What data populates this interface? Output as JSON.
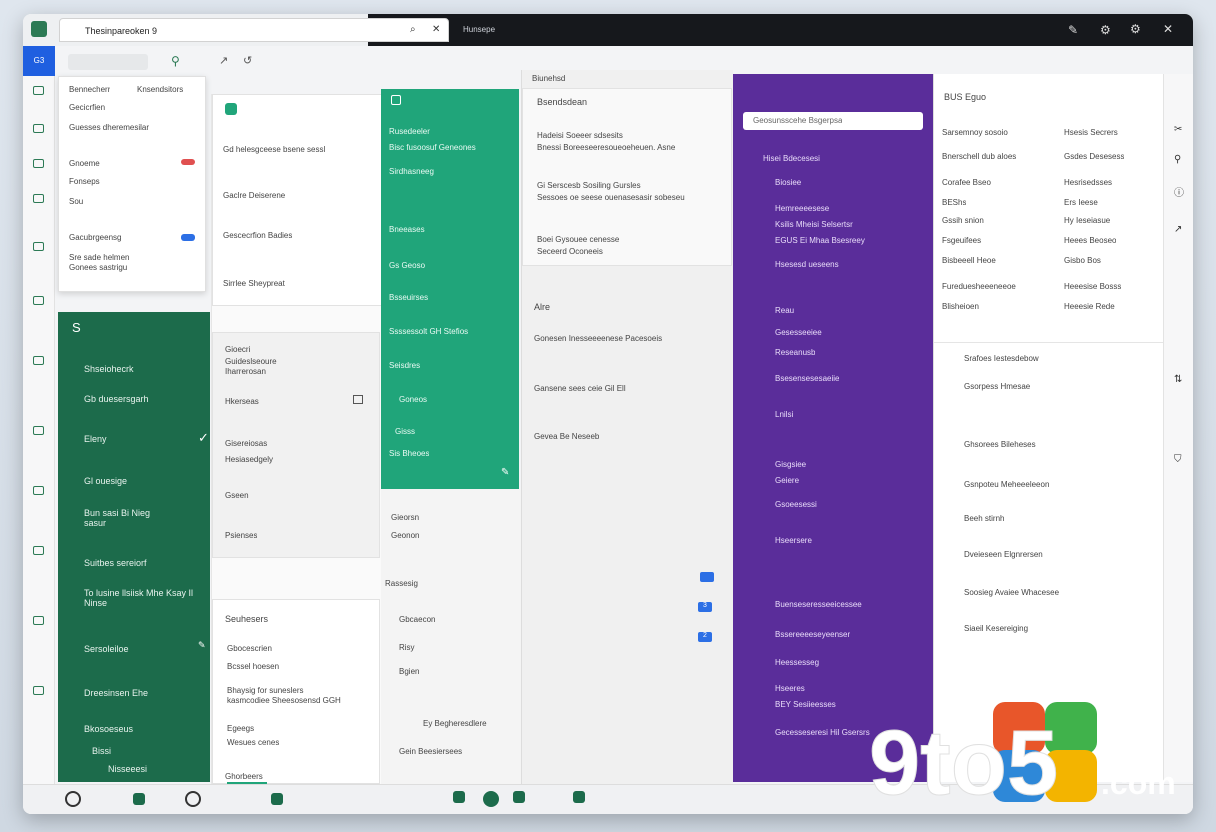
{
  "browser": {
    "active_tab": "Thesinpareoken 9",
    "dark_tab": "Hunsepe",
    "rail_active_label": "G3",
    "addr_text": "Biunehsd"
  },
  "dropdown": {
    "header_left": "Bennecherr",
    "header_right": "Knsendsitors",
    "items": [
      "Gecicrfien",
      "Guesses dheremesilar",
      "Gnoeme",
      "Fonseps",
      "Sou",
      "Gacubrgeensg",
      "Sre sade helmen Gonees sastrigu"
    ]
  },
  "green_panel": {
    "letter": "S",
    "items": [
      "Shseiohecrk",
      "Gb duesersgarh",
      "Eleny",
      "Gl ouesige",
      "Bun sasi Bi Nieg sasur",
      "Suitbes sereiorf",
      "To lusine llsiisk Mhe Ksay Il Ninse",
      "Sersoleiloe",
      "Dreesinsen Ehe",
      "Bkosoeseus",
      "Bissi",
      "Nisseeesi"
    ]
  },
  "column2": {
    "top_card": [
      "Gd helesgceese bsene sessl",
      "Gaclre Deiserene",
      "Gescecrfion Badies",
      "Sirrlee Sheypreat"
    ],
    "mid_card": [
      "Gioecri",
      "Guideslseoure Iharrerosan",
      "Hkerseas",
      "Gisereiosas",
      "Hesiasedgely",
      "Gseen",
      "Psienses"
    ],
    "section_title": "Seuhesers",
    "list": [
      "Gbocescrien",
      "Bcssel hoesen",
      "Bhaysig for suneslers kasmcodiee Sheesosensd GGH",
      "Egeegs",
      "Wesues cenes",
      "Ghorbeers"
    ]
  },
  "teal_panel": {
    "items": [
      "Rusedeeler",
      "Bisc fusoosuf Geneones",
      "Sirdhasneeg",
      "Bneeases",
      "Gs Geoso",
      "Bsseuirses",
      "Ssssessolt GH Stefios",
      "Seisdres",
      "Goneos",
      "Gisss",
      "Sis Bheoes"
    ]
  },
  "column3": {
    "items": [
      "Gieorsn",
      "Geonon",
      "Rassesig",
      "Gbcaecon",
      "Risy",
      "Bgien",
      "Ey Begheresdlere",
      "Gein Beesiersees"
    ]
  },
  "column4": {
    "title": "Bsendsdean",
    "block1": [
      "Hadeisi Soeeer sdsesits",
      "Bnessi Boreeseeresoueoeheuen. Asne"
    ],
    "block2": [
      "Gi Serscesb Sosiling Gursles",
      "Sessoes oe seese ouenasesasir sobeseu"
    ],
    "block3": [
      "Boei Gysouee cenesse",
      "Seceerd Oconeeis"
    ],
    "section": "Alre",
    "items": [
      "Gonesen Inesseeeenese Pacesoeis",
      "Gansene sees ceie Gil Ell",
      "Gevea Be Neseeb"
    ],
    "counts": [
      "3",
      "2"
    ]
  },
  "purple_panel": {
    "search_placeholder": "Geosunsscehe Bsgerpsa",
    "header": "Hisei Bdecesesi",
    "items": [
      "Biosiee",
      "Hemreeeesese",
      "Ksilis Mheisi Selsertsr",
      "EGUS Ei Mhaa Bsesreey",
      "Hsesesd ueseens",
      "Reau",
      "Gesesseeiee",
      "Reseanusb",
      "Bsesensesesaeiie",
      "Lnilsi",
      "Gisgsiee",
      "Geiere",
      "Gsoeesessi",
      "Hseersere",
      "Buenseseresseeicessee",
      "Bssereeeeseyeenser",
      "Heessesseg",
      "Hseeres",
      "BEY Sesiieesses",
      "Gecesseseresi Hil Gsersrs"
    ]
  },
  "column6": {
    "title": "BUS Eguo",
    "rows": [
      [
        "Sarsemnoy sosoio",
        "Hsesis Secrers"
      ],
      [
        "Bnerschell dub aloes",
        "Gsdes Desesess"
      ],
      [
        "Corafee Bseo",
        "Hesrisedsses"
      ],
      [
        "BEShs",
        "Ers Ieese"
      ],
      [
        "Gssih snion",
        "Hy Ieseiasue"
      ],
      [
        "Fsgeuifees",
        "Heees Beoseo"
      ],
      [
        "Bisbeeell Heoe",
        "Gisbo Bos"
      ],
      [
        "Fureduesheeeneeoe",
        "Heeesise Bosss"
      ],
      [
        "Blisheioen",
        "Heeesie Rede"
      ]
    ],
    "list": [
      "Srafoes Iestesdebow",
      "Gsorpess Hmesae",
      "Ghsorees Bileheses",
      "Gsnpoteu Meheeeleeon",
      "Beeh stirnh",
      "Dveieseen Elgnrersen",
      "Soosieg Avaiee Whacesee",
      "Siaeil Kesereiging"
    ]
  },
  "logo": {
    "text_9to5": "9to5",
    "text_com": ".com"
  }
}
